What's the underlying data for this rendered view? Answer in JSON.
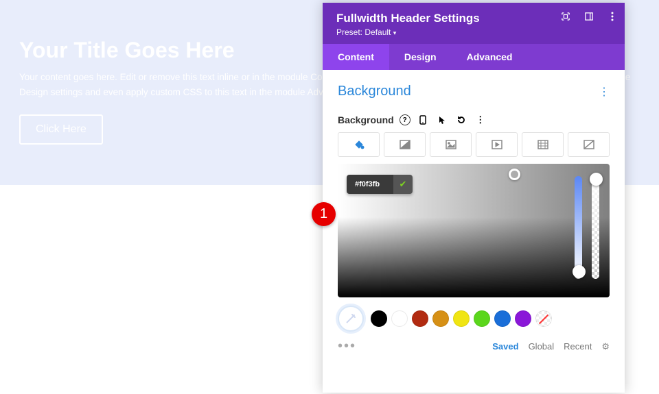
{
  "hero": {
    "title": "Your Title Goes Here",
    "desc": "Your content goes here. Edit or remove this text inline or in the module Content settings. You can also style every aspect of this content in the module Design settings and even apply custom CSS to this text in the module Advanced settings.",
    "button": "Click Here"
  },
  "panel": {
    "title": "Fullwidth Header Settings",
    "preset_label": "Preset:",
    "preset_value": "Default",
    "tabs": {
      "content": "Content",
      "design": "Design",
      "advanced": "Advanced"
    }
  },
  "background": {
    "section_label": "Background",
    "field_label": "Background",
    "hex": "#f0f3fb",
    "swatches": [
      "#000000",
      "#ffffff",
      "#b22b11",
      "#d69016",
      "#f0e513",
      "#5bd61c",
      "#1a6ed8",
      "#8a17d8"
    ],
    "links": {
      "saved": "Saved",
      "global": "Global",
      "recent": "Recent"
    }
  },
  "annotation": {
    "number": "1"
  }
}
